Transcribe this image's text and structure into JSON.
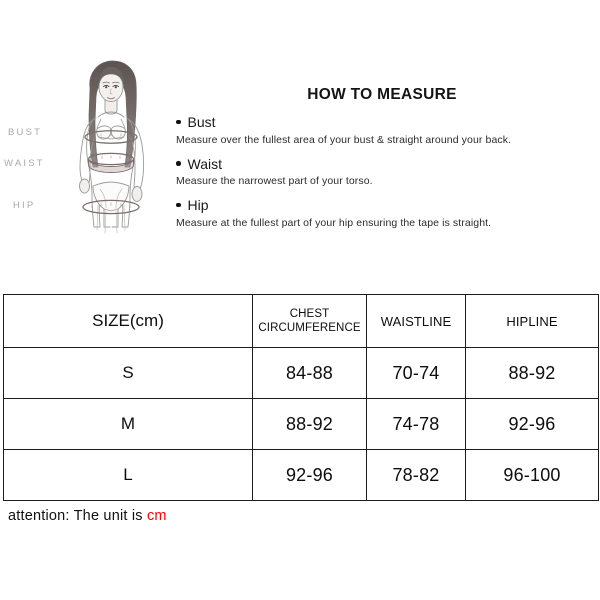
{
  "figure": {
    "alt_name": "female-body-measurement-illustration",
    "labels": {
      "bust": "BUST",
      "waist": "WAIST",
      "hip": "HIP"
    },
    "label_color": "#a8a8a8",
    "line_color": "#8a8a8a",
    "tape_color": "#7d6b6b"
  },
  "howto": {
    "title": "HOW TO MEASURE",
    "items": [
      {
        "heading": "Bust",
        "description": "Measure over the fullest area of your bust & straight around your back."
      },
      {
        "heading": "Waist",
        "description": "Measure the narrowest part of your torso."
      },
      {
        "heading": "Hip",
        "description": "Measure at the fullest part of your hip ensuring the tape is straight."
      }
    ]
  },
  "table": {
    "headers": [
      "SIZE(cm)",
      "CHEST CIRCUMFERENCE",
      "WAISTLINE",
      "HIPLINE"
    ],
    "header_chest_line1": "CHEST",
    "header_chest_line2": "CIRCUMFERENCE",
    "rows": [
      {
        "size": "S",
        "chest": "84-88",
        "waist": "70-74",
        "hip": "88-92"
      },
      {
        "size": "M",
        "chest": "88-92",
        "waist": "74-78",
        "hip": "92-96"
      },
      {
        "size": "L",
        "chest": "92-96",
        "waist": "78-82",
        "hip": "96-100"
      }
    ],
    "border_color": "#1c1c1c"
  },
  "attention": {
    "text": "attention:  The unit is ",
    "unit": "cm",
    "unit_color": "#ff0000"
  }
}
